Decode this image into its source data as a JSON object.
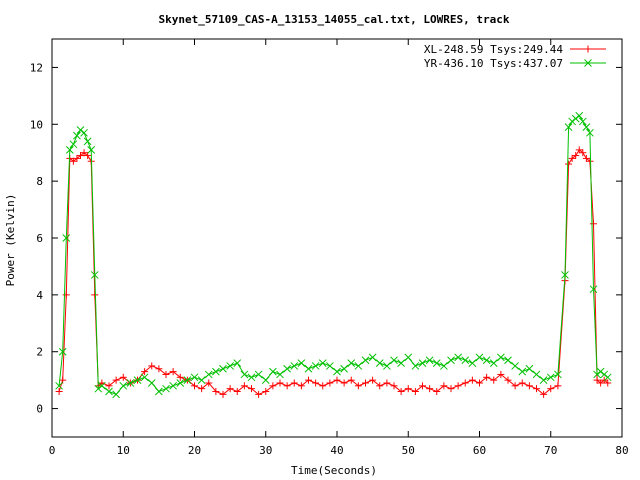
{
  "chart_data": {
    "type": "line",
    "title": "Skynet_57109_CAS-A_13153_14055_cal.txt, LOWRES, track",
    "xlabel": "Time(Seconds)",
    "ylabel": "Power (Kelvin)",
    "xlim": [
      0,
      80
    ],
    "ylim": [
      -1,
      13
    ],
    "xticks": [
      0,
      10,
      20,
      30,
      40,
      50,
      60,
      70,
      80
    ],
    "yticks": [
      0,
      2,
      4,
      6,
      8,
      10,
      12
    ],
    "grid": false,
    "legend_position": "top-right",
    "series": [
      {
        "name": "XL-248.59 Tsys:249.44",
        "color": "#ff0000",
        "marker": "+",
        "x": [
          1,
          1.5,
          2,
          2.5,
          3,
          3.5,
          4,
          4.5,
          5,
          5.5,
          6,
          6.5,
          7,
          8,
          9,
          10,
          11,
          12,
          13,
          14,
          15,
          16,
          17,
          18,
          19,
          20,
          21,
          22,
          23,
          24,
          25,
          26,
          27,
          28,
          29,
          30,
          31,
          32,
          33,
          34,
          35,
          36,
          37,
          38,
          39,
          40,
          41,
          42,
          43,
          44,
          45,
          46,
          47,
          48,
          49,
          50,
          51,
          52,
          53,
          54,
          55,
          56,
          57,
          58,
          59,
          60,
          61,
          62,
          63,
          64,
          65,
          66,
          67,
          68,
          69,
          70,
          71,
          72,
          72.5,
          73,
          73.5,
          74,
          74.5,
          75,
          75.5,
          76,
          76.5,
          77,
          77.5,
          78
        ],
        "y": [
          0.6,
          1.0,
          4.0,
          8.8,
          8.7,
          8.8,
          8.9,
          9.0,
          8.9,
          8.7,
          4.0,
          0.8,
          0.9,
          0.8,
          1.0,
          1.1,
          0.9,
          1.0,
          1.3,
          1.5,
          1.4,
          1.2,
          1.3,
          1.1,
          1.0,
          0.8,
          0.7,
          0.9,
          0.6,
          0.5,
          0.7,
          0.6,
          0.8,
          0.7,
          0.5,
          0.6,
          0.8,
          0.9,
          0.8,
          0.9,
          0.8,
          1.0,
          0.9,
          0.8,
          0.9,
          1.0,
          0.9,
          1.0,
          0.8,
          0.9,
          1.0,
          0.8,
          0.9,
          0.8,
          0.6,
          0.7,
          0.6,
          0.8,
          0.7,
          0.6,
          0.8,
          0.7,
          0.8,
          0.9,
          1.0,
          0.9,
          1.1,
          1.0,
          1.2,
          1.0,
          0.8,
          0.9,
          0.8,
          0.7,
          0.5,
          0.7,
          0.8,
          4.5,
          8.6,
          8.8,
          8.9,
          9.1,
          9.0,
          8.8,
          8.7,
          6.5,
          1.0,
          0.9,
          1.0,
          0.9
        ]
      },
      {
        "name": "YR-436.10 Tsys:437.07",
        "color": "#00c000",
        "marker": "x",
        "x": [
          1,
          1.5,
          2,
          2.5,
          3,
          3.5,
          4,
          4.5,
          5,
          5.5,
          6,
          6.5,
          7,
          8,
          9,
          10,
          11,
          12,
          13,
          14,
          15,
          16,
          17,
          18,
          19,
          20,
          21,
          22,
          23,
          24,
          25,
          26,
          27,
          28,
          29,
          30,
          31,
          32,
          33,
          34,
          35,
          36,
          37,
          38,
          39,
          40,
          41,
          42,
          43,
          44,
          45,
          46,
          47,
          48,
          49,
          50,
          51,
          52,
          53,
          54,
          55,
          56,
          57,
          58,
          59,
          60,
          61,
          62,
          63,
          64,
          65,
          66,
          67,
          68,
          69,
          70,
          71,
          72,
          72.5,
          73,
          73.5,
          74,
          74.5,
          75,
          75.5,
          76,
          76.5,
          77,
          77.5,
          78
        ],
        "y": [
          0.8,
          2.0,
          6.0,
          9.1,
          9.3,
          9.6,
          9.8,
          9.7,
          9.4,
          9.1,
          4.7,
          0.7,
          0.8,
          0.6,
          0.5,
          0.8,
          0.9,
          1.0,
          1.1,
          0.9,
          0.6,
          0.7,
          0.8,
          0.9,
          1.0,
          1.1,
          1.0,
          1.2,
          1.3,
          1.4,
          1.5,
          1.6,
          1.2,
          1.1,
          1.2,
          1.0,
          1.3,
          1.2,
          1.4,
          1.5,
          1.6,
          1.4,
          1.5,
          1.6,
          1.5,
          1.3,
          1.4,
          1.6,
          1.5,
          1.7,
          1.8,
          1.6,
          1.5,
          1.7,
          1.6,
          1.8,
          1.5,
          1.6,
          1.7,
          1.6,
          1.5,
          1.7,
          1.8,
          1.7,
          1.6,
          1.8,
          1.7,
          1.6,
          1.8,
          1.7,
          1.5,
          1.3,
          1.4,
          1.2,
          1.0,
          1.1,
          1.2,
          4.7,
          9.9,
          10.1,
          10.2,
          10.3,
          10.1,
          9.9,
          9.7,
          4.2,
          1.2,
          1.3,
          1.2,
          1.1
        ]
      }
    ]
  }
}
